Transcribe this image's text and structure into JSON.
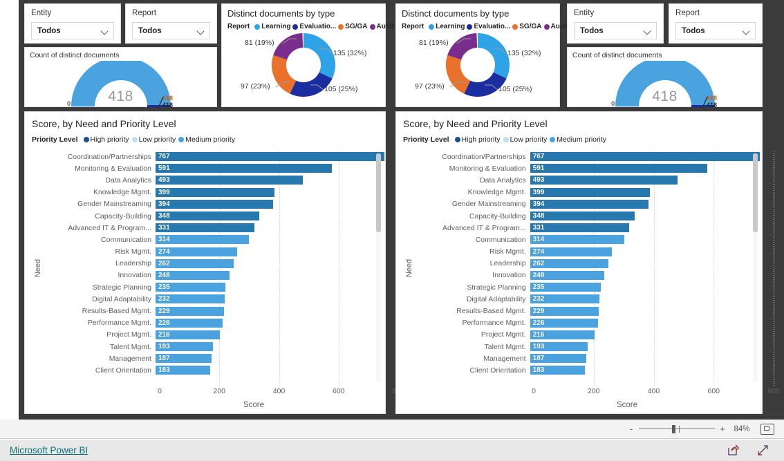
{
  "app": {
    "footer_link": "Microsoft Power BI"
  },
  "toolbar": {
    "zoom_minus": "-",
    "zoom_plus": "+",
    "zoom_percent": "84%",
    "fit_icon": "fit-to-page-icon",
    "share_icon": "share-icon",
    "fullscreen_icon": "fullscreen-icon"
  },
  "colors": {
    "learning": "#2fa3e8",
    "evaluation": "#1b2ea0",
    "sgga": "#e8722c",
    "audit": "#7b2d8e",
    "high_priority": "#1b4f8a",
    "low_priority": "#bfe0f2",
    "medium_priority": "#4aa3df",
    "bar_dark": "#2878b0",
    "bar_medium": "#4aa3df",
    "gauge_fill": "#4aa3df",
    "link": "#0f6d74",
    "canvas": "#3b3b3b"
  },
  "slicers": {
    "entity": {
      "title": "Entity",
      "value": "Todos",
      "chevron": "chevron-down-icon"
    },
    "report": {
      "title": "Report",
      "value": "Todos",
      "chevron": "chevron-down-icon"
    }
  },
  "gauge": {
    "title": "Count of distinct documents",
    "value": "418",
    "min": "0",
    "max_top": "418",
    "max_bottom": "418"
  },
  "donut": {
    "title": "Distinct documents by type",
    "legend_label": "Report",
    "legend": [
      {
        "name": "Learning",
        "color": "#2fa3e8"
      },
      {
        "name": "Evaluatio...",
        "color": "#1b2ea0"
      },
      {
        "name": "SG/GA",
        "color": "#e8722c"
      },
      {
        "name": "Audit",
        "color": "#7b2d8e"
      }
    ],
    "labels": {
      "learning": "135 (32%)",
      "evaluation": "105 (25%)",
      "sgga": "97 (23%)",
      "audit": "81 (19%)"
    }
  },
  "barchart": {
    "title": "Score, by Need and Priority Level",
    "legend_label": "Priority Level",
    "legend": [
      {
        "name": "High priority",
        "color": "#1b4f8a"
      },
      {
        "name": "Low priority",
        "color": "#bfe0f2"
      },
      {
        "name": "Medium priority",
        "color": "#4aa3df"
      }
    ],
    "ylabel": "Need",
    "xlabel": "Score"
  },
  "chart_data": [
    {
      "type": "pie",
      "title": "Distinct documents by type",
      "legend_title": "Report",
      "legend_position": "top",
      "categories": [
        "Learning",
        "Evaluatio...",
        "SG/GA",
        "Audit"
      ],
      "values": [
        135,
        105,
        97,
        81
      ],
      "percentages": [
        "32%",
        "23%",
        "19%",
        "25%"
      ],
      "data_labels": [
        "135 (32%)",
        "105 (25%)",
        "97 (23%)",
        "81 (19%)"
      ],
      "colors": [
        "#2fa3e8",
        "#1b2ea0",
        "#e8722c",
        "#7b2d8e"
      ],
      "total": 418
    },
    {
      "type": "bar",
      "title": "Score, by Need and Priority Level",
      "xlabel": "Score",
      "ylabel": "Need",
      "legend_title": "Priority Level",
      "legend": [
        "High priority",
        "Low priority",
        "Medium priority"
      ],
      "legend_position": "top",
      "orientation": "horizontal",
      "xlim": [
        0,
        800
      ],
      "xticks": [
        "0",
        "200",
        "400",
        "600",
        "800"
      ],
      "grid": true,
      "categories": [
        "Coordination/Partnerships",
        "Monitoring & Evaluation",
        "Data Analytics",
        "Knowledge Mgmt.",
        "Gender Mainstreaming",
        "Capacity-Building",
        "Advanced IT & Program...",
        "Communication",
        "Risk Mgmt.",
        "Leadership",
        "Innovation",
        "Strategic Planning",
        "Digital Adaptability",
        "Results-Based Mgmt.",
        "Performance Mgmt.",
        "Project Mgmt.",
        "Talent Mgmt.",
        "Management",
        "Client Orientation"
      ],
      "values": [
        767,
        591,
        493,
        399,
        394,
        348,
        331,
        314,
        274,
        262,
        248,
        235,
        232,
        229,
        226,
        216,
        193,
        187,
        183
      ],
      "bar_colors": [
        "#2878b0",
        "#2878b0",
        "#2878b0",
        "#2878b0",
        "#2878b0",
        "#2878b0",
        "#2878b0",
        "#4aa3df",
        "#4aa3df",
        "#4aa3df",
        "#4aa3df",
        "#4aa3df",
        "#4aa3df",
        "#4aa3df",
        "#4aa3df",
        "#4aa3df",
        "#4aa3df",
        "#4aa3df",
        "#4aa3df"
      ]
    },
    {
      "type": "bar",
      "title": "Count of distinct documents",
      "subtype": "gauge",
      "value": 418,
      "min": 0,
      "max": 418,
      "target": 418
    }
  ]
}
